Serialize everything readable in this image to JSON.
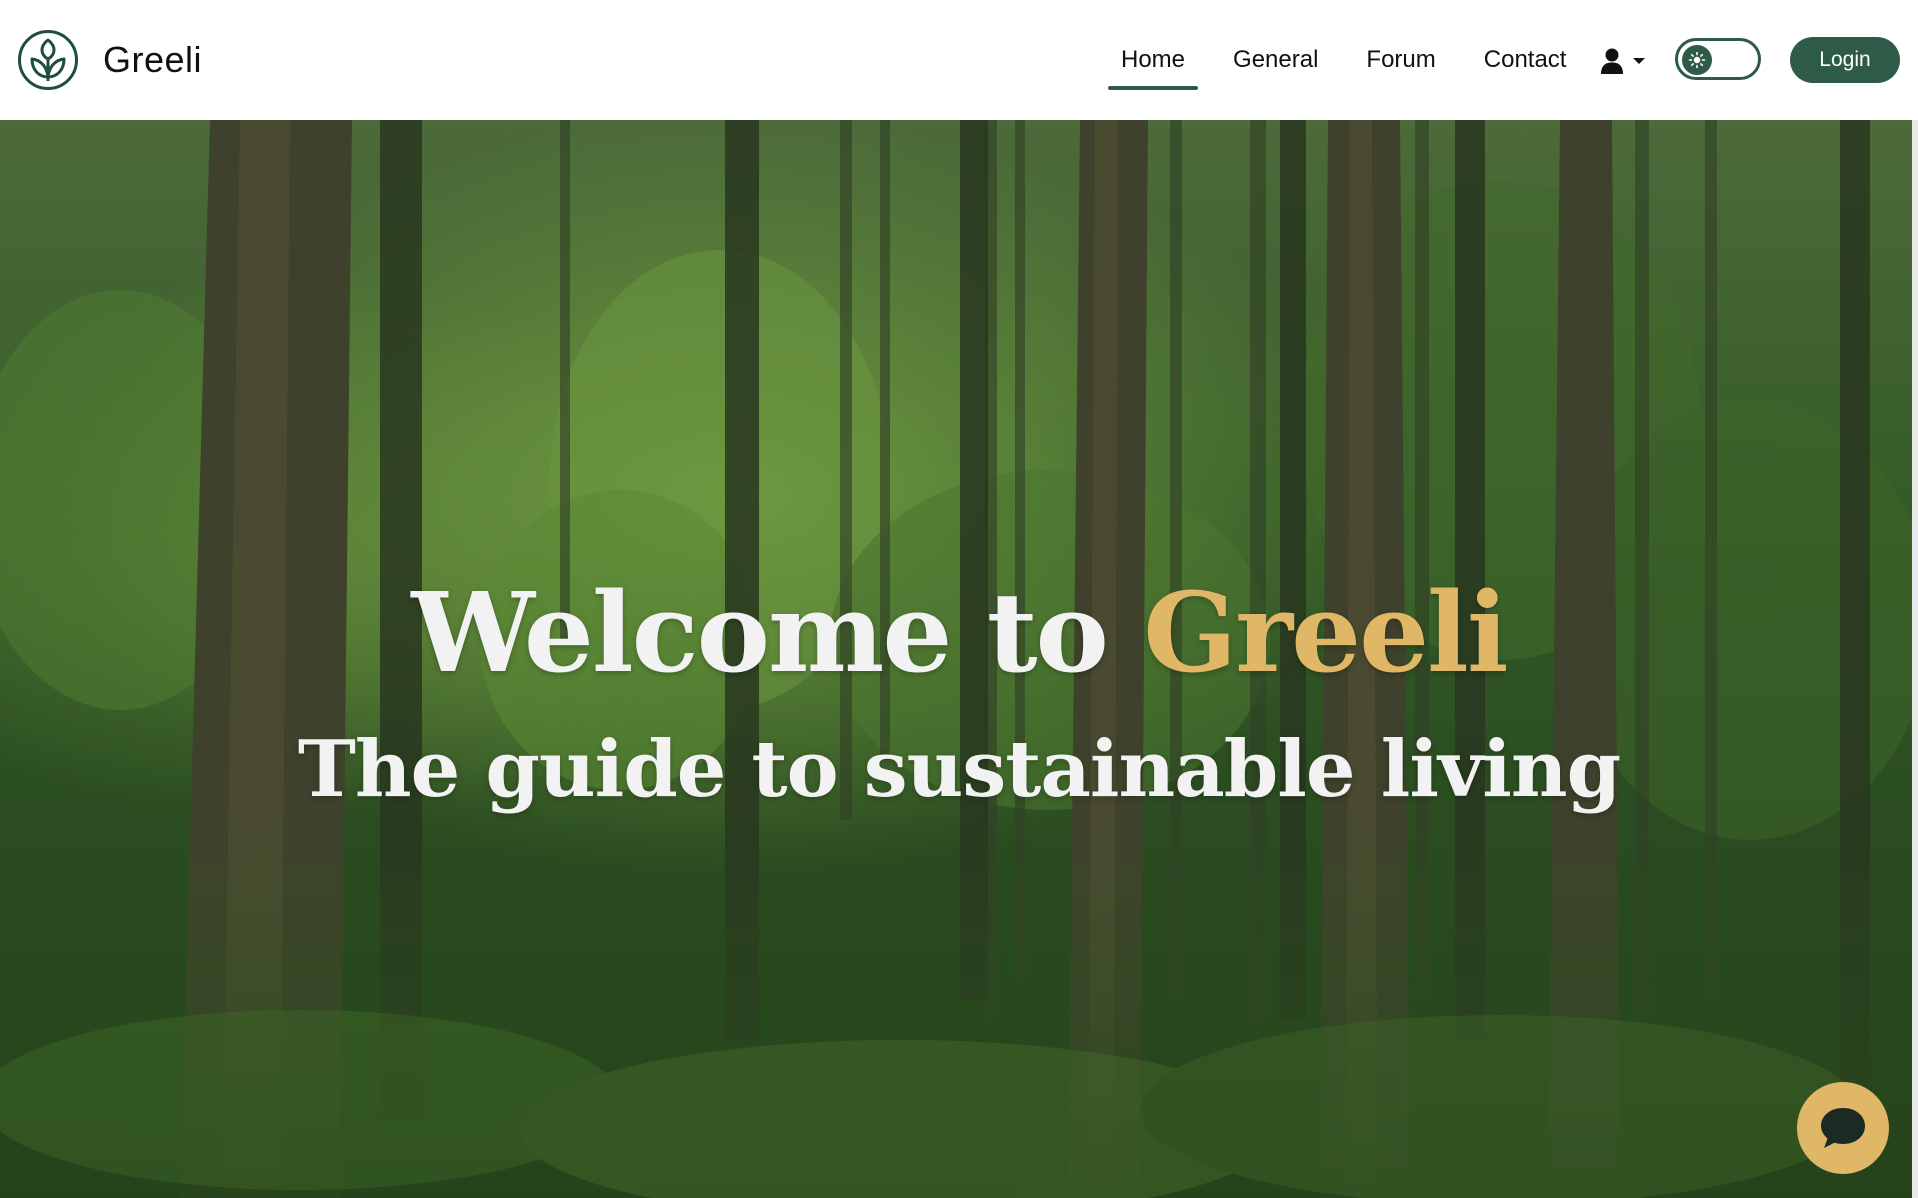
{
  "brand": {
    "name": "Greeli",
    "logo_icon": "sprout-leaf-icon"
  },
  "nav": {
    "items": [
      {
        "label": "Home",
        "active": true
      },
      {
        "label": "General",
        "active": false
      },
      {
        "label": "Forum",
        "active": false
      },
      {
        "label": "Contact",
        "active": false
      }
    ],
    "user_menu_icon": "user-icon",
    "dropdown_icon": "caret-down-icon",
    "theme_toggle": {
      "state": "light",
      "icon": "sun-icon"
    },
    "login_label": "Login"
  },
  "hero": {
    "title_prefix": "Welcome to ",
    "title_accent": "Greeli",
    "subtitle": "The guide to sustainable living",
    "background": "forest-photo"
  },
  "chat": {
    "icon": "chat-bubble-icon"
  },
  "colors": {
    "brand_green": "#2e5a48",
    "accent_gold": "#e0b766",
    "hero_text": "#f2f2f2",
    "nav_text": "#111111"
  }
}
